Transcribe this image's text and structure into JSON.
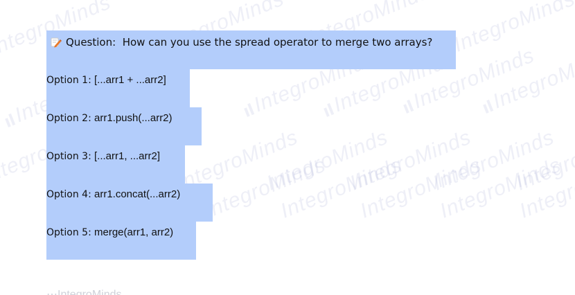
{
  "question": {
    "label": "Question:",
    "text": "How can you use the spread operator to merge two arrays?"
  },
  "options": [
    {
      "label": "Option 1:",
      "value": "[...arr1 + ...arr2]"
    },
    {
      "label": "Option 2:",
      "value": "arr1.push(...arr2)"
    },
    {
      "label": "Option 3:",
      "value": "[...arr1, ...arr2]"
    },
    {
      "label": "Option 4:",
      "value": "arr1.concat(...arr2)"
    },
    {
      "label": "Option 5:",
      "value": "merge(arr1, arr2)"
    }
  ],
  "watermark": {
    "text": "IntegroMinds",
    "color": "#7887be"
  },
  "footer": {
    "brand": "IntegroMinds"
  },
  "colors": {
    "highlight": "#b3cdfb",
    "text": "#111111",
    "pencil_icon": "#e8782a"
  }
}
